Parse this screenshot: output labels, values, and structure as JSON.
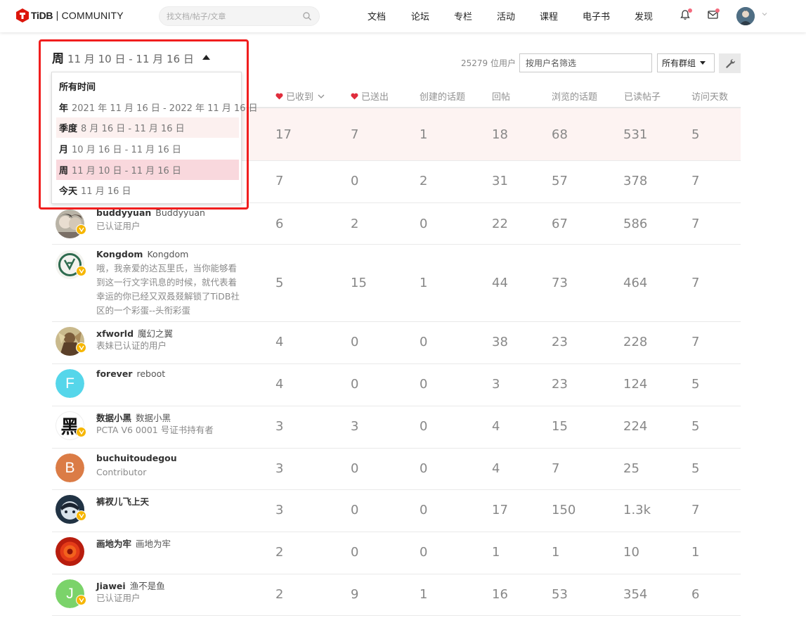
{
  "header": {
    "brand": "TiDB",
    "separator": "|",
    "community": "COMMUNITY",
    "search_placeholder": "找文档/帖子/文章",
    "nav": [
      "文档",
      "论坛",
      "专栏",
      "活动",
      "课程",
      "电子书",
      "发现"
    ],
    "icons": [
      "search-icon",
      "bell-icon",
      "mail-icon",
      "chevron-down-icon"
    ],
    "brand_color": "#dc150b",
    "notification_dot_color": "#f36a7d"
  },
  "period": {
    "current_unit": "周",
    "current_range": "11 月 10 日 - 11 月 16 日",
    "options": [
      {
        "unit": "所有时间",
        "range": ""
      },
      {
        "unit": "年",
        "range": "2021 年 11 月 16 日 - 2022 年 11 月 16 日"
      },
      {
        "unit": "季度",
        "range": "8 月 16 日 - 11 月 16 日"
      },
      {
        "unit": "月",
        "range": "10 月 16 日 - 11 月 16 日"
      },
      {
        "unit": "周",
        "range": "11 月 10 日 - 11 月 16 日"
      },
      {
        "unit": "今天",
        "range": "11 月 16 日"
      }
    ]
  },
  "toolbar": {
    "user_count": "25279 位用户",
    "filter_placeholder": "按用户名筛选",
    "group_label": "所有群组"
  },
  "columns": [
    "已收到",
    "已送出",
    "创建的话题",
    "回帖",
    "浏览的话题",
    "已读帖子",
    "访问天数"
  ],
  "rows": [
    {
      "username": "",
      "name": "",
      "title": "",
      "values": [
        "17",
        "7",
        "1",
        "18",
        "68",
        "531",
        "5"
      ]
    },
    {
      "username": "",
      "name": "",
      "title": "",
      "values": [
        "7",
        "0",
        "2",
        "31",
        "57",
        "378",
        "7"
      ]
    },
    {
      "username": "buddyyuan",
      "name": "Buddyyuan",
      "title": "已认证用户",
      "values": [
        "6",
        "2",
        "0",
        "22",
        "67",
        "586",
        "7"
      ]
    },
    {
      "username": "Kongdom",
      "name": "Kongdom",
      "title": "哦，我亲爱的达瓦里氏，当你能够看到这一行文字讯息的时候，就代表着幸运的你已经又双叒叕解锁了TiDB社区的一个彩蛋--头衔彩蛋",
      "values": [
        "5",
        "15",
        "1",
        "44",
        "73",
        "464",
        "7"
      ]
    },
    {
      "username": "xfworld",
      "name": "魔幻之翼",
      "title": "表妹已认证的用户",
      "values": [
        "4",
        "0",
        "0",
        "38",
        "23",
        "228",
        "7"
      ]
    },
    {
      "username": "forever",
      "name": "reboot",
      "title": "",
      "values": [
        "4",
        "0",
        "0",
        "3",
        "23",
        "124",
        "5"
      ]
    },
    {
      "username": "数据小黑",
      "name": "数据小黑",
      "title": "PCTA V6 0001 号证书持有者",
      "values": [
        "3",
        "3",
        "0",
        "4",
        "15",
        "224",
        "5"
      ]
    },
    {
      "username": "buchuitoudegou",
      "name": "",
      "title": "Contributor",
      "values": [
        "3",
        "0",
        "0",
        "4",
        "7",
        "25",
        "5"
      ]
    },
    {
      "username": "裤衩儿飞上天",
      "name": "",
      "title": "",
      "values": [
        "3",
        "0",
        "0",
        "17",
        "150",
        "1.3k",
        "7"
      ]
    },
    {
      "username": "画地为牢",
      "name": "画地为牢",
      "title": "",
      "values": [
        "2",
        "0",
        "0",
        "1",
        "1",
        "10",
        "1"
      ]
    },
    {
      "username": "Jiawei",
      "name": "渔不是鱼",
      "title": "已认证用户",
      "values": [
        "2",
        "9",
        "1",
        "16",
        "53",
        "354",
        "6"
      ]
    }
  ],
  "avatars": {
    "forever": {
      "letter": "F",
      "color": "#55d6ea"
    },
    "buchuitoudegou": {
      "letter": "B",
      "color": "#db7c46"
    },
    "jiawei": {
      "letter": "J",
      "color": "#7bd36a"
    },
    "kuro": {
      "glyph": "黑"
    }
  }
}
